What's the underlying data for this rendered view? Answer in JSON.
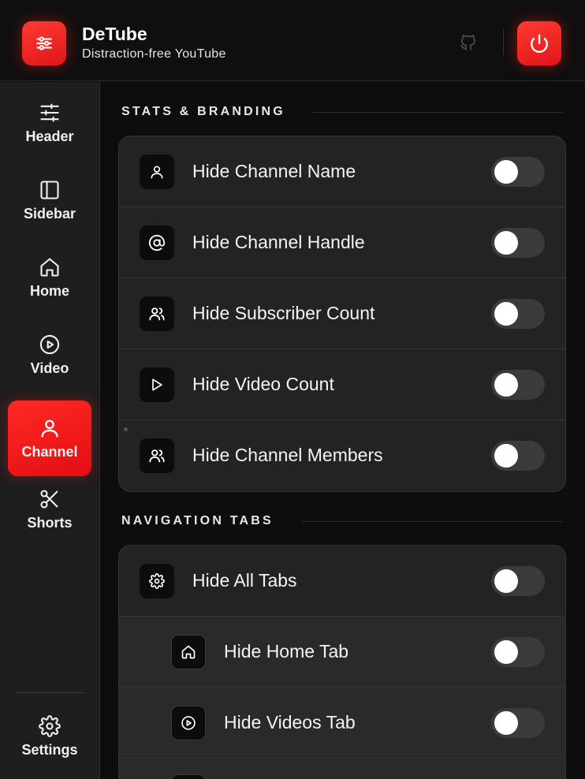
{
  "header": {
    "title": "DeTube",
    "subtitle": "Distraction-free YouTube",
    "logo_icon": "sliders-icon",
    "github_icon": "github-icon",
    "power_icon": "power-icon"
  },
  "sidebar": {
    "items": [
      {
        "label": "Header",
        "icon": "sliders-icon",
        "active": false
      },
      {
        "label": "Sidebar",
        "icon": "sidebar-panel-icon",
        "active": false
      },
      {
        "label": "Home",
        "icon": "home-icon",
        "active": false
      },
      {
        "label": "Video",
        "icon": "play-circle-icon",
        "active": false
      },
      {
        "label": "Channel",
        "icon": "user-icon",
        "active": true
      },
      {
        "label": "Shorts",
        "icon": "scissors-icon",
        "active": false
      }
    ],
    "settings": {
      "label": "Settings",
      "icon": "gear-icon"
    }
  },
  "sections": [
    {
      "title": "STATS & BRANDING",
      "rows": [
        {
          "label": "Hide Channel Name",
          "icon": "user-icon",
          "enabled": false,
          "sub": false
        },
        {
          "label": "Hide Channel Handle",
          "icon": "at-icon",
          "enabled": false,
          "sub": false
        },
        {
          "label": "Hide Subscriber Count",
          "icon": "users-icon",
          "enabled": false,
          "sub": false
        },
        {
          "label": "Hide Video Count",
          "icon": "play-icon",
          "enabled": false,
          "sub": false
        },
        {
          "label": "Hide Channel Members",
          "icon": "users-icon",
          "enabled": false,
          "sub": false
        }
      ]
    },
    {
      "title": "NAVIGATION TABS",
      "rows": [
        {
          "label": "Hide All Tabs",
          "icon": "gear-icon",
          "enabled": false,
          "sub": false
        },
        {
          "label": "Hide Home Tab",
          "icon": "home-icon",
          "enabled": false,
          "sub": true
        },
        {
          "label": "Hide Videos Tab",
          "icon": "play-circle-icon",
          "enabled": false,
          "sub": true
        }
      ]
    }
  ],
  "colors": {
    "accent": "#ff2a22",
    "toggle_off": "#3b3b3b",
    "card": "#232323"
  }
}
